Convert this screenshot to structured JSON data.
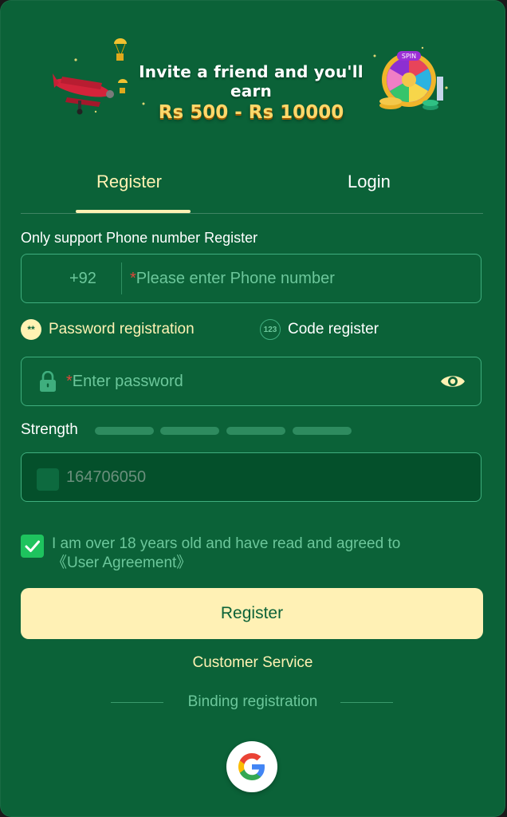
{
  "banner": {
    "line1": "Invite a friend and you'll earn",
    "line2": "Rs 500 - Rs 10000",
    "wheel_label": "SPIN"
  },
  "tabs": [
    {
      "label": "Register",
      "active": true
    },
    {
      "label": "Login",
      "active": false
    }
  ],
  "form": {
    "support_hint": "Only support Phone number Register",
    "country_code": "+92",
    "phone_placeholder": "Please enter Phone number",
    "required_mark": "*",
    "mode_password_label": "Password registration",
    "mode_password_icon": "**",
    "mode_code_label": "Code register",
    "mode_code_icon": "123",
    "password_placeholder": "Enter password",
    "strength_label": "Strength",
    "strength_level": 0,
    "captcha_value": "164706050",
    "agree_text_line1": "I am over 18 years old and have read and agreed to",
    "agree_text_line2": "《User Agreement》",
    "agree_checked": true,
    "register_button": "Register",
    "customer_service": "Customer Service",
    "binding_registration": "Binding registration"
  },
  "colors": {
    "background": "#0b6238",
    "accent": "#fff2b3",
    "muted": "#6cc79b",
    "border": "#3fae7e",
    "required": "#e0473a",
    "checkbox": "#1ec35e"
  },
  "icons": [
    "airplane-icon",
    "spin-wheel-icon",
    "lock-icon",
    "eye-icon",
    "checkmark-icon",
    "google-icon"
  ]
}
